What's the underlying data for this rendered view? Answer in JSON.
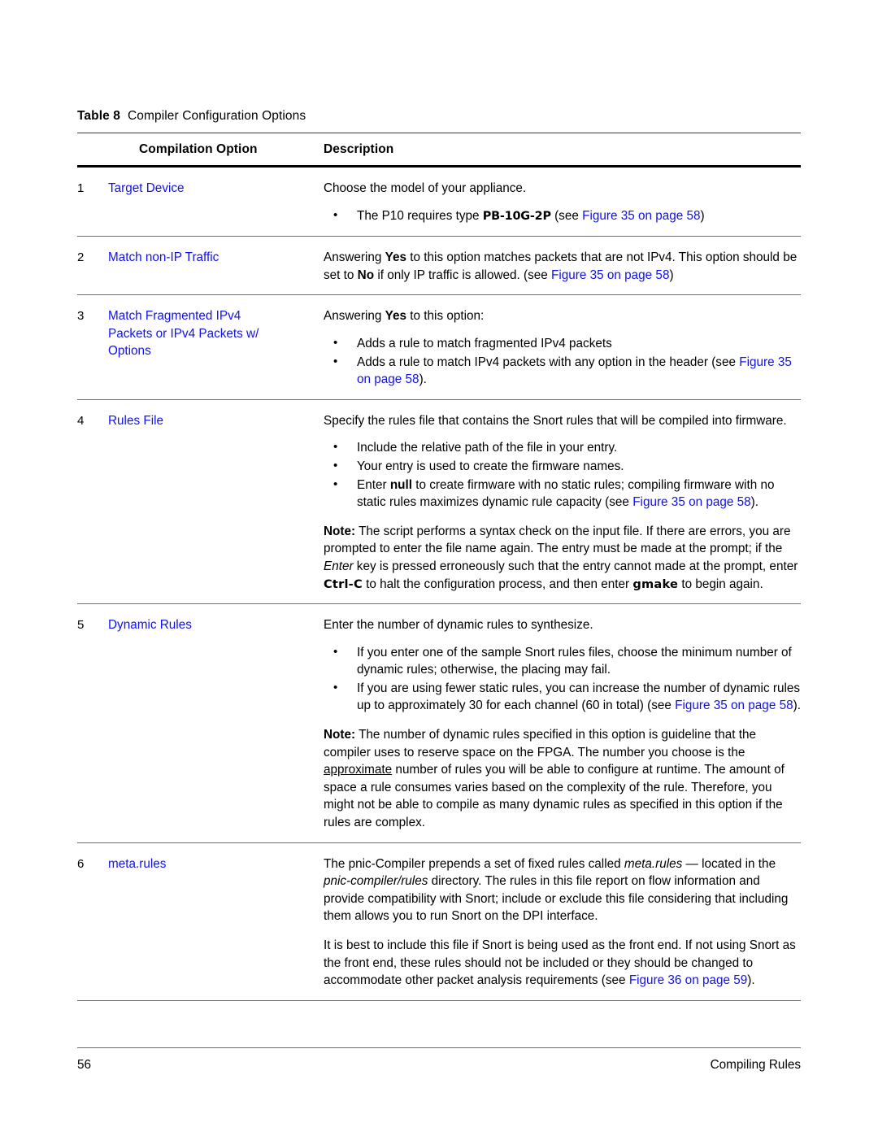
{
  "caption": {
    "label": "Table 8",
    "text": "Compiler Configuration Options"
  },
  "table": {
    "headers": {
      "option": "Compilation Option",
      "description": "Description"
    },
    "rows": [
      {
        "num": "1",
        "option": "Target Device",
        "intro": "Choose the model of your appliance.",
        "bullets": {
          "b1_a": "The P10 requires type ",
          "b1_mono": "PB-10G-2P",
          "b1_b": " (see ",
          "b1_link": "Figure 35 on page 58",
          "b1_c": ")"
        }
      },
      {
        "num": "2",
        "option": "Match non-IP Traffic",
        "p1_a": "Answering ",
        "p1_yes": "Yes",
        "p1_b": " to this option matches packets that are not IPv4. This option should be set to ",
        "p1_no": "No",
        "p1_c": " if only IP traffic is allowed. (see ",
        "p1_link": "Figure 35 on page 58",
        "p1_d": ")"
      },
      {
        "num": "3",
        "option_l1": "Match Fragmented IPv4",
        "option_l2": "Packets or IPv4 Packets w/",
        "option_l3": "Options",
        "intro_a": "Answering ",
        "intro_yes": "Yes",
        "intro_b": " to this option:",
        "bullet1": "Adds a rule to match fragmented IPv4 packets",
        "bullet2_a": "Adds a rule to match IPv4 packets with any option in the header (see ",
        "bullet2_link": "Figure 35 on page 58",
        "bullet2_b": ")."
      },
      {
        "num": "4",
        "option": "Rules File",
        "intro": "Specify the rules file that contains the Snort rules that will be compiled into firmware.",
        "bullet1": "Include the relative path of the file in your entry.",
        "bullet2": "Your entry is used to create the firmware names.",
        "bullet3_a": "Enter ",
        "bullet3_null": "null",
        "bullet3_b": " to create firmware with no static rules; compiling firmware with no static rules maximizes dynamic rule capacity (see ",
        "bullet3_link": "Figure 35 on page 58",
        "bullet3_c": ").",
        "note_label": "Note:",
        "note_a": " The script performs a syntax check on the input file. If there are errors, you are prompted to enter the file name again. The entry must be made at the prompt; if the ",
        "note_enter": "Enter",
        "note_b": " key is pressed erroneously such that the entry cannot made at the prompt, enter ",
        "note_ctrlc": "Ctrl-C",
        "note_c": " to halt the configuration process, and then enter ",
        "note_gmake": "gmake",
        "note_d": " to begin again."
      },
      {
        "num": "5",
        "option": "Dynamic Rules",
        "intro": "Enter the number of dynamic rules to synthesize.",
        "bullet1": "If you enter one of the sample Snort rules files, choose the minimum number of dynamic rules; otherwise, the placing may fail.",
        "bullet2_a": "If you are using fewer static rules, you can increase the number of dynamic rules up to approximately 30 for each channel (60 in total) (see ",
        "bullet2_link": "Figure 35 on page 58",
        "bullet2_b": ").",
        "note_label": "Note:",
        "note_a": " The number of dynamic rules specified in this option is guideline that the compiler uses to reserve space on the FPGA. The number you choose is the ",
        "note_approx": "approximate",
        "note_b": " number of rules you will be able to configure at runtime. The amount of space a rule consumes varies based on the complexity of the rule. Therefore, you might not be able to compile as many dynamic rules as specified in this option if the rules are complex."
      },
      {
        "num": "6",
        "option": "meta.rules",
        "p1_a": "The pnic-Compiler prepends a set of fixed rules called ",
        "p1_meta": "meta.rules",
        "p1_b": " — located in the ",
        "p1_dir": "pnic-compiler/rules",
        "p1_c": " directory. The rules in this file report on flow information and provide compatibility with Snort; include or exclude this file considering that including them allows you to run Snort on the DPI interface.",
        "p2_a": "It is best to include this file if Snort is being used as the front end. If not using Snort as the front end, these rules should not be included or they should be changed to accommodate other packet analysis requirements (see ",
        "p2_link": "Figure 36 on page 59",
        "p2_b": ")."
      }
    ]
  },
  "footer": {
    "page_number": "56",
    "section_title": "Compiling Rules"
  },
  "colors": {
    "link": "#1111ee",
    "text": "#000000",
    "rule": "#6b6b6b"
  }
}
